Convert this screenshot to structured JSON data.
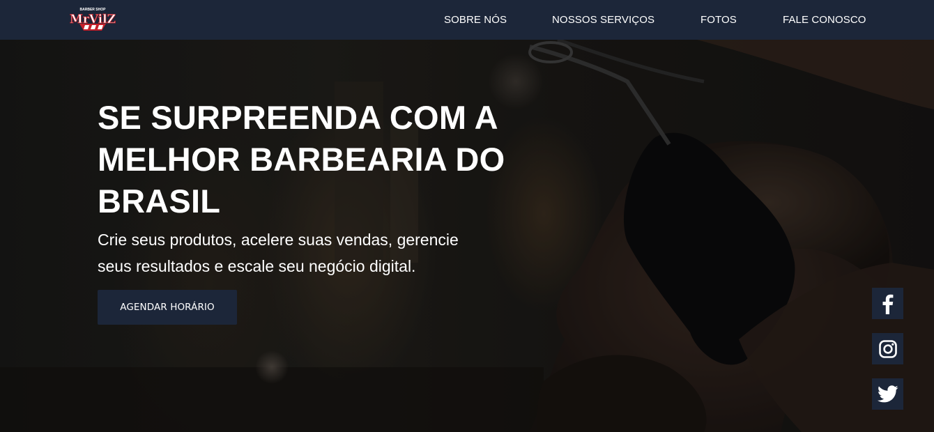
{
  "brand": {
    "logo_top_text": "BARBER SHOP",
    "logo_main_text": "MrVilZ",
    "colors": {
      "navy": "#1c2639",
      "logo_red": "#c4202a",
      "white": "#ffffff"
    }
  },
  "nav": {
    "items": [
      {
        "label": "SOBRE NÓS"
      },
      {
        "label": "NOSSOS SERVIÇOS"
      },
      {
        "label": "FOTOS"
      },
      {
        "label": "FALE CONOSCO"
      }
    ]
  },
  "hero": {
    "title_line1": "SE SURPREENDA COM A",
    "title_line2": "MELHOR BARBEARIA DO",
    "title_line3": "BRASIL",
    "subtitle_line1": "Crie seus produtos, acelere suas vendas, gerencie",
    "subtitle_line2": "seus resultados e escale seu negócio digital.",
    "cta_label": "AGENDAR HORÁRIO",
    "background_description_icon": "barber-cutting-hair-photo"
  },
  "social": [
    {
      "icon": "facebook-icon"
    },
    {
      "icon": "instagram-icon"
    },
    {
      "icon": "twitter-icon"
    }
  ]
}
